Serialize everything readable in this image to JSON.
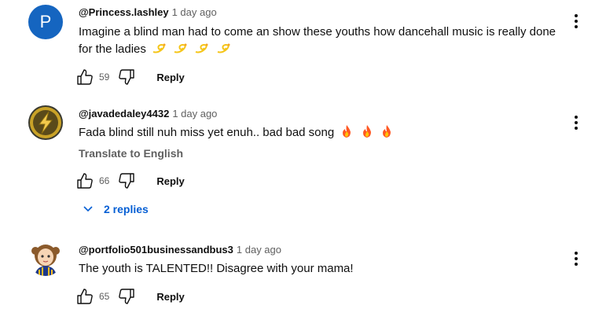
{
  "comments": [
    {
      "author": "@Princess.lashley",
      "time": "1 day ago",
      "avatar_letter": "P",
      "text": "Imagine a blind man had to come an show these youths how dancehall music is really done for the ladies",
      "emoji": [
        "dizzy",
        "dizzy",
        "dizzy",
        "dizzy"
      ],
      "likes": "59",
      "reply_label": "Reply"
    },
    {
      "author": "@javadedaley4432",
      "time": "1 day ago",
      "text": "Fada blind still nuh miss yet enuh.. bad bad song",
      "emoji": [
        "fire",
        "fire",
        "fire"
      ],
      "translate_label": "Translate to English",
      "likes": "66",
      "reply_label": "Reply",
      "replies_label": "2 replies"
    },
    {
      "author": "@portfolio501businessandbus3",
      "time": "1 day ago",
      "text": "The youth is TALENTED!! Disagree with your mama!",
      "likes": "65",
      "reply_label": "Reply"
    }
  ],
  "colors": {
    "link_blue": "#065fd4",
    "avatar_blue": "#1565c0",
    "muted": "#606060"
  }
}
